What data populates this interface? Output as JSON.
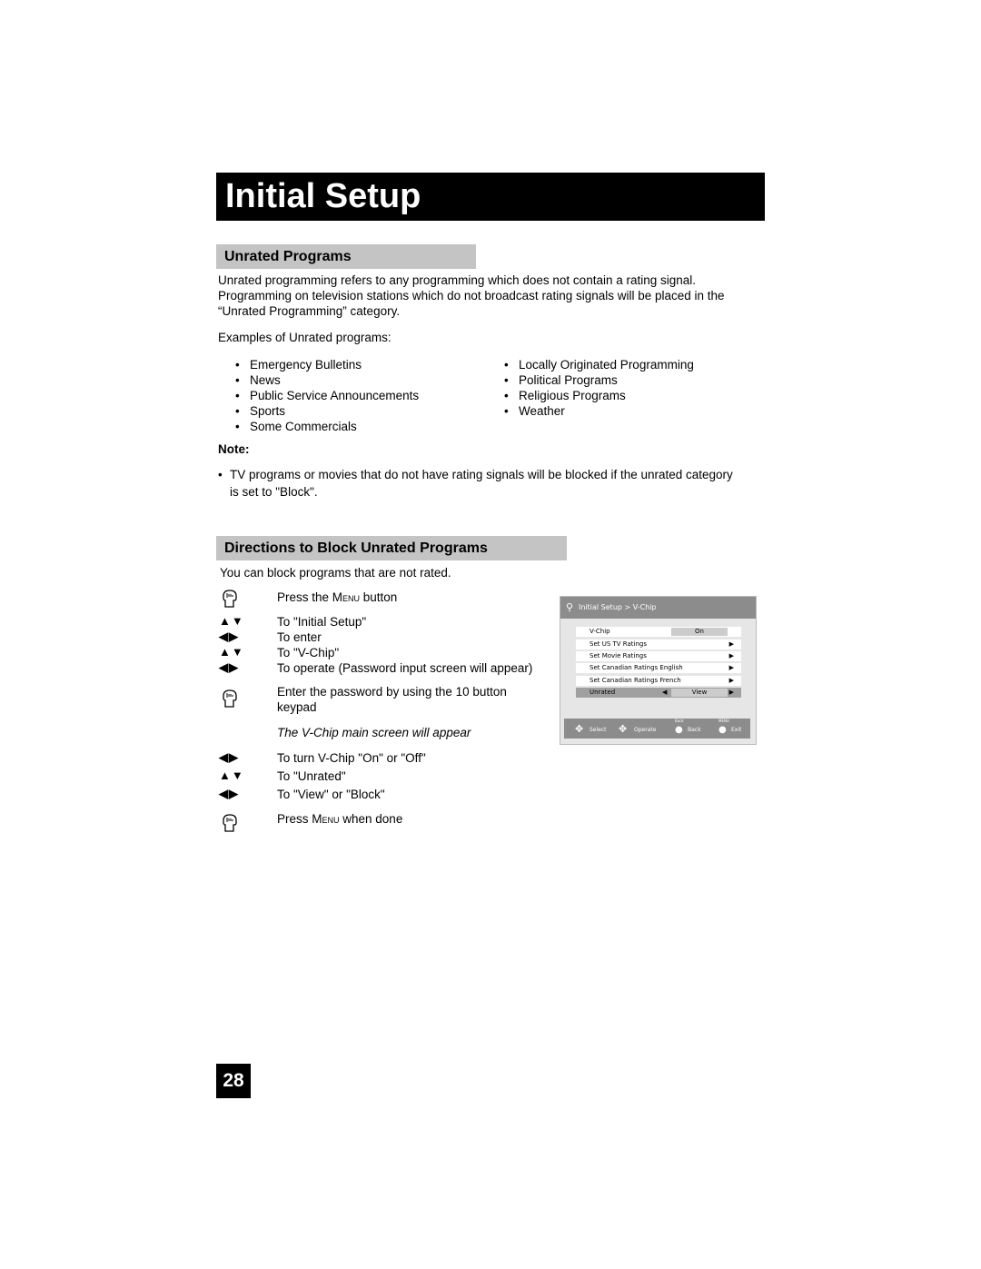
{
  "title": "Initial Setup",
  "section1": {
    "heading": "Unrated Programs",
    "para": [
      "Unrated programming refers to any programming which does not contain a rating signal.",
      "Programming on television stations which do not broadcast rating signals will be placed in the",
      "“Unrated Programming” category."
    ],
    "examples_label": "Examples of Unrated programs:",
    "left_list": [
      "Emergency Bulletins",
      "News",
      "Public Service Announcements",
      "Sports",
      "Some Commercials"
    ],
    "right_list": [
      "Locally Originated Programming",
      "Political Programs",
      "Religious Programs",
      "Weather"
    ],
    "note_label": "Note:",
    "note_text": [
      "TV programs or movies that do not have rating signals will be blocked if the unrated category",
      "is set to \"Block\"."
    ]
  },
  "section2": {
    "heading": "Directions to Block Unrated Programs",
    "intro": "You can block programs that are not rated.",
    "steps": [
      {
        "icon": "hand",
        "pre": "Press the ",
        "sc": "Menu",
        "post": " button"
      },
      {
        "icon": "▲▼",
        "text": "To \"Initial Setup\""
      },
      {
        "icon": "◀▶",
        "text": "To enter"
      },
      {
        "icon": "▲▼",
        "text": "To \"V-Chip\""
      },
      {
        "icon": "◀▶",
        "text": "To operate (Password input screen will appear)"
      },
      {
        "icon": "hand",
        "text1": "Enter the password by using the 10 button",
        "text2": "keypad"
      },
      {
        "italic": "The V-Chip main screen will appear"
      },
      {
        "icon": "◀▶",
        "text": "To turn V-Chip \"On\" or \"Off\""
      },
      {
        "icon": "▲▼",
        "text": "To \"Unrated\""
      },
      {
        "icon": "◀▶",
        "text": "To \"View\" or \"Block\""
      },
      {
        "icon": "hand",
        "pre": "Press ",
        "sc": "Menu",
        "post": " when done"
      }
    ]
  },
  "tv_screen": {
    "breadcrumb": "Initial Setup > V-Chip",
    "rows": [
      {
        "label": "V-Chip",
        "value": "On"
      },
      {
        "label": "Set US TV Ratings",
        "arrow": "▶"
      },
      {
        "label": "Set Movie Ratings",
        "arrow": "▶"
      },
      {
        "label": "Set Canadian Ratings English",
        "arrow": "▶"
      },
      {
        "label": "Set Canadian Ratings French",
        "arrow": "▶"
      },
      {
        "label": "Unrated",
        "value": "View"
      }
    ],
    "footer": {
      "select": "Select",
      "operate": "Operate",
      "back_small": "Back",
      "back": "Back",
      "menu_small": "MENU",
      "exit": "Exit"
    }
  },
  "page_number": "28"
}
